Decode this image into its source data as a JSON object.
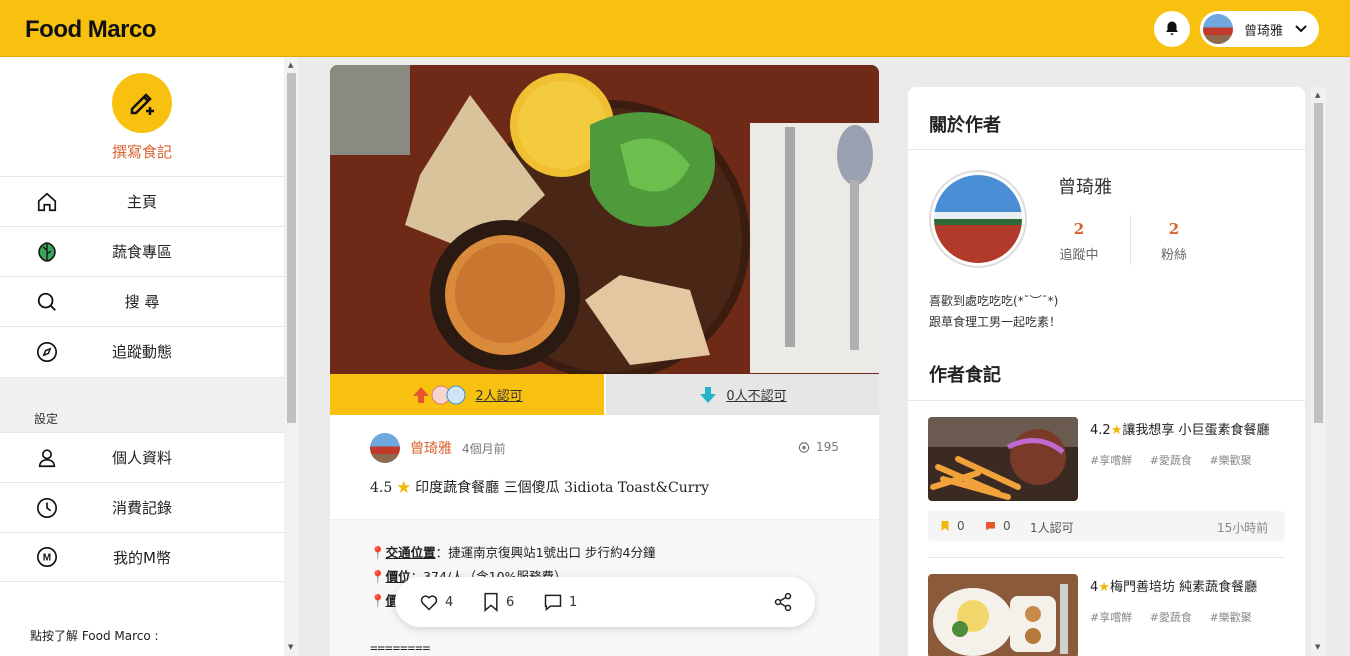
{
  "header": {
    "logo": "Food Marco",
    "user_name": "曾琦雅"
  },
  "sidebar": {
    "write_label": "撰寫食記",
    "items": [
      {
        "label": "主頁",
        "icon": "home-icon"
      },
      {
        "label": "蔬食專區",
        "icon": "leaf-icon"
      },
      {
        "label": "搜 尋",
        "icon": "search-icon"
      },
      {
        "label": "追蹤動態",
        "icon": "compass-icon"
      }
    ],
    "settings_title": "設定",
    "settings_items": [
      {
        "label": "個人資料",
        "icon": "user-icon"
      },
      {
        "label": "消費記錄",
        "icon": "clock-icon"
      },
      {
        "label": "我的M幣",
        "icon": "m-coin-icon"
      }
    ],
    "footer_text": "點按了解 Food Marco :"
  },
  "post": {
    "upvote_text": "2人認可",
    "downvote_text": "0人不認可",
    "author_name": "曾琦雅",
    "time_ago": "4個月前",
    "views": "195",
    "rating": "4.5",
    "title": "印度蔬食餐廳 三個傻瓜 3idiota Toast&Curry",
    "body": [
      {
        "label": "交通位置",
        "text": "：捷運南京復興站1號出口 步行約4分鐘"
      },
      {
        "label": "價位",
        "text": "：374/人（含10%服務費）"
      },
      {
        "label": "價",
        "text": ""
      }
    ],
    "separator": "========",
    "likes": "4",
    "bookmarks": "6",
    "comments": "1"
  },
  "about": {
    "title": "關於作者",
    "name": "曾琦雅",
    "following_count": "2",
    "following_label": "追蹤中",
    "followers_count": "2",
    "followers_label": "粉絲",
    "bio_line1": "喜歡到處吃吃吃(*¯︶¯*)",
    "bio_line2": "跟草食理工男一起吃素！"
  },
  "author_posts": {
    "title": "作者食記",
    "items": [
      {
        "rating": "4.2",
        "title": "讓我想享 小巨蛋素食餐廳",
        "tags": [
          "#享嚐鮮",
          "#愛蔬食",
          "#樂歡聚"
        ],
        "bookmarks": "0",
        "comments": "0",
        "approvals": "1人認可",
        "time": "15小時前"
      },
      {
        "rating": "4",
        "title": "梅門善培坊 純素蔬食餐廳",
        "tags": [
          "#享嚐鮮",
          "#愛蔬食",
          "#樂歡聚"
        ]
      }
    ]
  },
  "colors": {
    "brand": "#f9c10f",
    "accent": "#d9622b"
  }
}
